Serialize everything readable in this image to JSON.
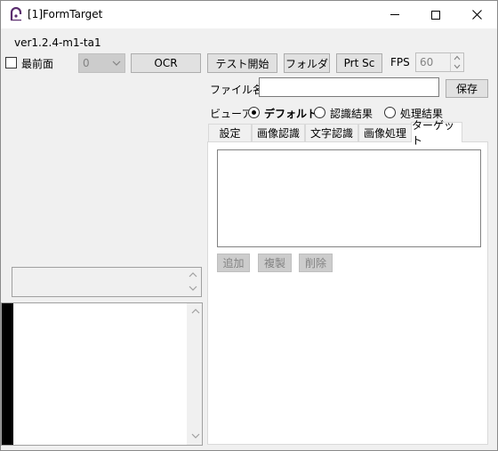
{
  "window": {
    "title": "[1]FormTarget",
    "version": "ver1.2.4-m1-ta1"
  },
  "toolbar": {
    "topmost_label": "最前面",
    "select_value": "0",
    "ocr_label": "OCR",
    "test_start_label": "テスト開始",
    "folder_label": "フォルダ",
    "prtsc_label": "Prt Sc",
    "fps_label": "FPS",
    "fps_value": "60"
  },
  "file": {
    "label": "ファイル名",
    "value": "",
    "save_label": "保存"
  },
  "viewer": {
    "label": "ビューア",
    "options": [
      {
        "label": "デフォルト",
        "checked": true
      },
      {
        "label": "認識結果",
        "checked": false
      },
      {
        "label": "処理結果",
        "checked": false
      }
    ]
  },
  "tabs": [
    {
      "label": "設定"
    },
    {
      "label": "画像認識"
    },
    {
      "label": "文字認識"
    },
    {
      "label": "画像処理"
    },
    {
      "label": "ターゲット"
    }
  ],
  "target": {
    "add_label": "追加",
    "copy_label": "複製",
    "delete_label": "削除"
  }
}
